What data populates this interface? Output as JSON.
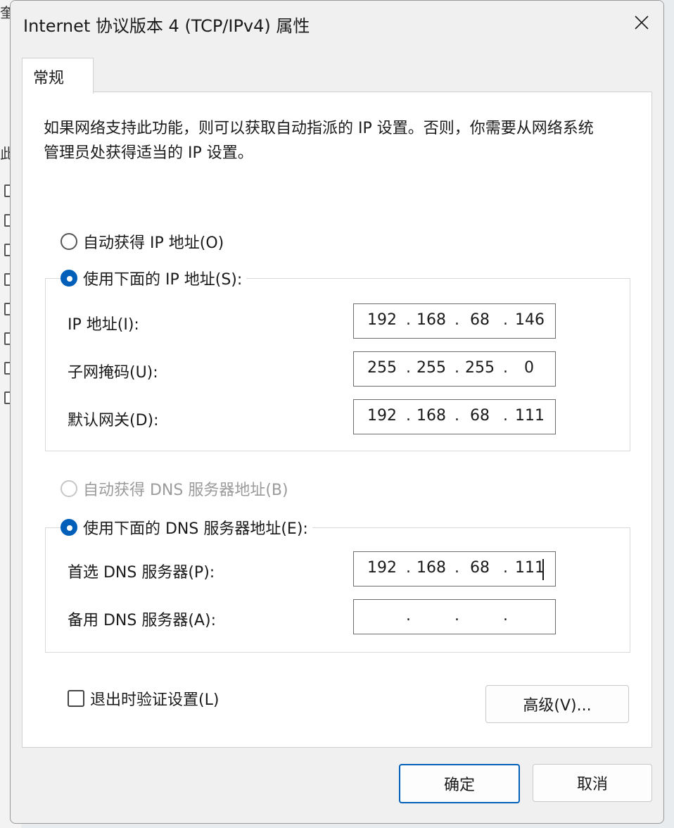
{
  "background": {
    "edge_char_top": "奎",
    "edge_char_mid": "此"
  },
  "dialog": {
    "title": "Internet 协议版本 4 (TCP/IPv4) 属性",
    "close_symbol": "×",
    "tab_general": "常规",
    "description": "如果网络支持此功能，则可以获取自动指派的 IP 设置。否则，你需要从网络系统管理员处获得适当的 IP 设置。",
    "ip_section": {
      "auto_label": "自动获得 IP 地址(O)",
      "manual_label": "使用下面的 IP 地址(S):",
      "selected": "manual",
      "fields": [
        {
          "label": "IP 地址(I):",
          "octets": [
            "192",
            "168",
            "68",
            "146"
          ]
        },
        {
          "label": "子网掩码(U):",
          "octets": [
            "255",
            "255",
            "255",
            "0"
          ]
        },
        {
          "label": "默认网关(D):",
          "octets": [
            "192",
            "168",
            "68",
            "111"
          ]
        }
      ]
    },
    "dns_section": {
      "auto_label": "自动获得 DNS 服务器地址(B)",
      "manual_label": "使用下面的 DNS 服务器地址(E):",
      "selected": "manual",
      "fields": [
        {
          "label": "首选 DNS 服务器(P):",
          "octets": [
            "192",
            "168",
            "68",
            "111"
          ]
        },
        {
          "label": "备用 DNS 服务器(A):",
          "octets": [
            "",
            "",
            "",
            ""
          ]
        }
      ]
    },
    "validate_label": "退出时验证设置(L)",
    "validate_checked": false,
    "advanced_button": "高级(V)...",
    "ok_button": "确定",
    "cancel_button": "取消",
    "dot": ".",
    "colors": {
      "accent": "#005fb8",
      "disabled_text": "#9b9b9b"
    }
  }
}
